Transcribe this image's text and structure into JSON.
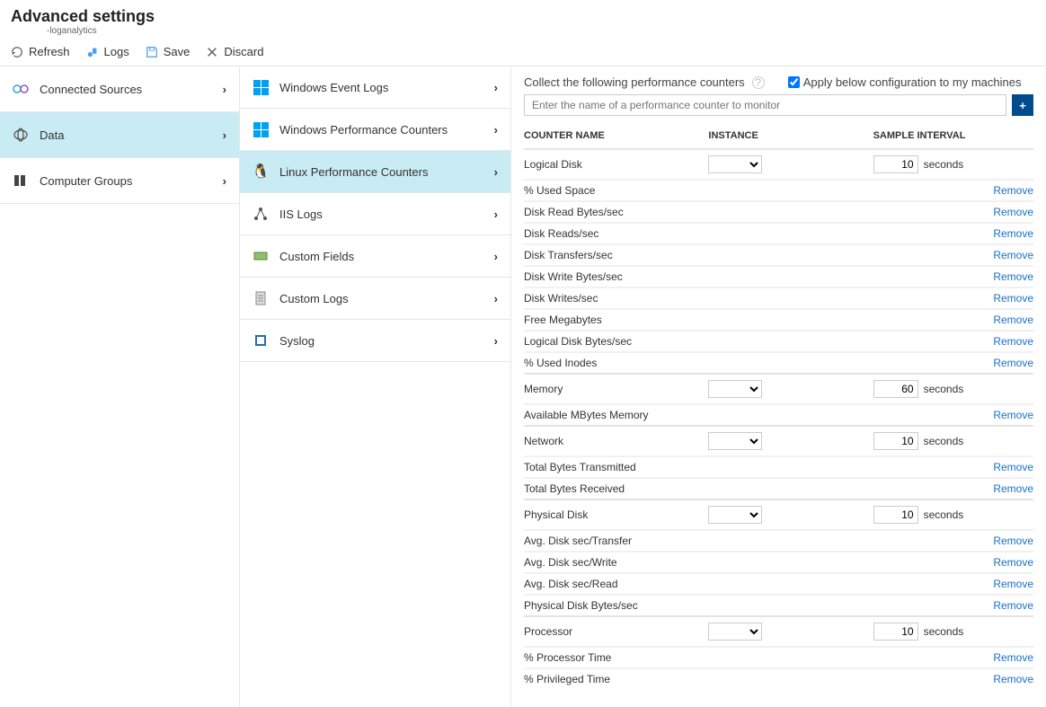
{
  "header": {
    "title": "Advanced settings",
    "subtitle": "-loganalytics"
  },
  "toolbar": {
    "refresh": "Refresh",
    "logs": "Logs",
    "save": "Save",
    "discard": "Discard"
  },
  "nav1": {
    "items": [
      {
        "label": "Connected Sources",
        "icon": "connected-sources-icon"
      },
      {
        "label": "Data",
        "icon": "data-icon",
        "selected": true
      },
      {
        "label": "Computer Groups",
        "icon": "computer-groups-icon"
      }
    ]
  },
  "nav2": {
    "items": [
      {
        "label": "Windows Event Logs",
        "icon": "windows-icon"
      },
      {
        "label": "Windows Performance Counters",
        "icon": "windows-icon"
      },
      {
        "label": "Linux Performance Counters",
        "icon": "linux-icon",
        "selected": true
      },
      {
        "label": "IIS Logs",
        "icon": "iis-icon"
      },
      {
        "label": "Custom Fields",
        "icon": "custom-fields-icon"
      },
      {
        "label": "Custom Logs",
        "icon": "custom-logs-icon"
      },
      {
        "label": "Syslog",
        "icon": "syslog-icon"
      }
    ]
  },
  "panel": {
    "heading": "Collect the following performance counters",
    "applyLabel": "Apply below configuration to my machines",
    "applyChecked": true,
    "searchPlaceholder": "Enter the name of a performance counter to monitor",
    "columns": {
      "name": "COUNTER NAME",
      "instance": "INSTANCE",
      "interval": "SAMPLE INTERVAL"
    },
    "secondsLabel": "seconds",
    "removeLabel": "Remove",
    "groups": [
      {
        "name": "Logical Disk",
        "interval": "10",
        "counters": [
          "% Used Space",
          "Disk Read Bytes/sec",
          "Disk Reads/sec",
          "Disk Transfers/sec",
          "Disk Write Bytes/sec",
          "Disk Writes/sec",
          "Free Megabytes",
          "Logical Disk Bytes/sec",
          "% Used Inodes"
        ]
      },
      {
        "name": "Memory",
        "interval": "60",
        "counters": [
          "Available MBytes Memory"
        ]
      },
      {
        "name": "Network",
        "interval": "10",
        "counters": [
          "Total Bytes Transmitted",
          "Total Bytes Received"
        ]
      },
      {
        "name": "Physical Disk",
        "interval": "10",
        "counters": [
          "Avg. Disk sec/Transfer",
          "Avg. Disk sec/Write",
          "Avg. Disk sec/Read",
          "Physical Disk Bytes/sec"
        ]
      },
      {
        "name": "Processor",
        "interval": "10",
        "counters": [
          "% Processor Time",
          "% Privileged Time"
        ]
      }
    ]
  }
}
